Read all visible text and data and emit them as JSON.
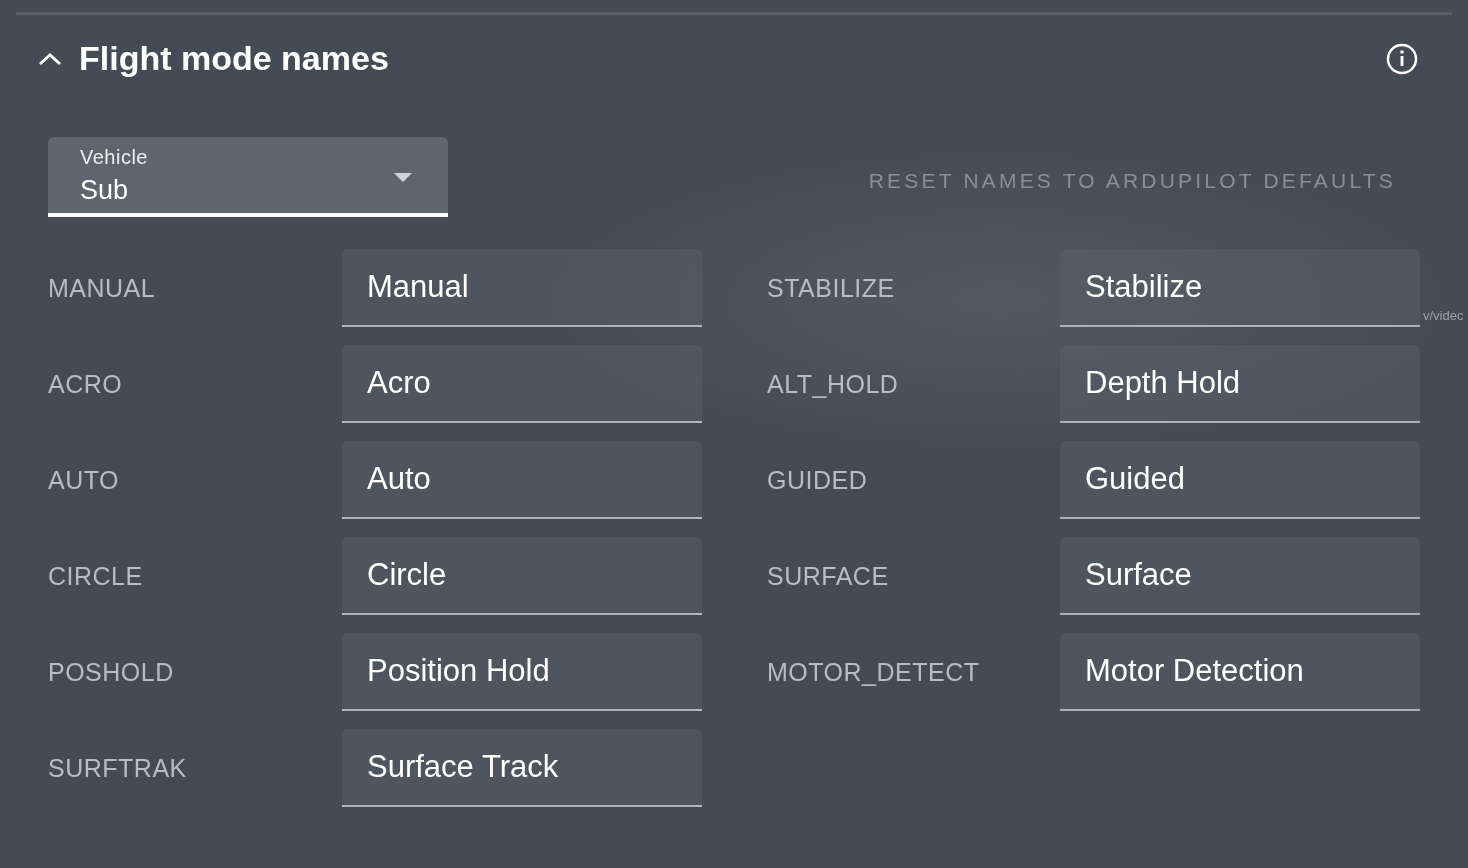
{
  "section": {
    "title": "Flight mode names",
    "expanded": true
  },
  "vehicle_select": {
    "label": "Vehicle",
    "value": "Sub"
  },
  "reset_button": "RESET NAMES TO ARDUPILOT DEFAULTS",
  "modes": [
    {
      "key": "MANUAL",
      "name": "Manual"
    },
    {
      "key": "STABILIZE",
      "name": "Stabilize"
    },
    {
      "key": "ACRO",
      "name": "Acro"
    },
    {
      "key": "ALT_HOLD",
      "name": "Depth Hold"
    },
    {
      "key": "AUTO",
      "name": "Auto"
    },
    {
      "key": "GUIDED",
      "name": "Guided"
    },
    {
      "key": "CIRCLE",
      "name": "Circle"
    },
    {
      "key": "SURFACE",
      "name": "Surface"
    },
    {
      "key": "POSHOLD",
      "name": "Position Hold"
    },
    {
      "key": "MOTOR_DETECT",
      "name": "Motor Detection"
    },
    {
      "key": "SURFTRAK",
      "name": "Surface Track"
    }
  ],
  "background_text": "v/videc"
}
